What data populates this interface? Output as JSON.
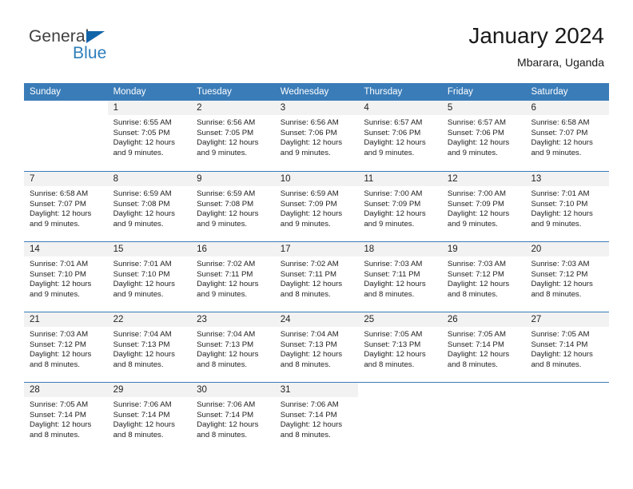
{
  "brand": {
    "name_top": "General",
    "name_bottom": "Blue",
    "color_top": "#3f3f3f",
    "color_bottom": "#2e7ebb",
    "triangle_color": "#1264a9"
  },
  "header": {
    "title": "January 2024",
    "subtitle": "Mbarara, Uganda"
  },
  "theme": {
    "header_band": "#3a7cb8",
    "day_number_band": "#f2f2f2",
    "text": "#222222"
  },
  "weekdays": [
    "Sunday",
    "Monday",
    "Tuesday",
    "Wednesday",
    "Thursday",
    "Friday",
    "Saturday"
  ],
  "weeks": [
    [
      {
        "num": "",
        "sunrise": "",
        "sunset": "",
        "daylight1": "",
        "daylight2": ""
      },
      {
        "num": "1",
        "sunrise": "Sunrise: 6:55 AM",
        "sunset": "Sunset: 7:05 PM",
        "daylight1": "Daylight: 12 hours",
        "daylight2": "and 9 minutes."
      },
      {
        "num": "2",
        "sunrise": "Sunrise: 6:56 AM",
        "sunset": "Sunset: 7:05 PM",
        "daylight1": "Daylight: 12 hours",
        "daylight2": "and 9 minutes."
      },
      {
        "num": "3",
        "sunrise": "Sunrise: 6:56 AM",
        "sunset": "Sunset: 7:06 PM",
        "daylight1": "Daylight: 12 hours",
        "daylight2": "and 9 minutes."
      },
      {
        "num": "4",
        "sunrise": "Sunrise: 6:57 AM",
        "sunset": "Sunset: 7:06 PM",
        "daylight1": "Daylight: 12 hours",
        "daylight2": "and 9 minutes."
      },
      {
        "num": "5",
        "sunrise": "Sunrise: 6:57 AM",
        "sunset": "Sunset: 7:06 PM",
        "daylight1": "Daylight: 12 hours",
        "daylight2": "and 9 minutes."
      },
      {
        "num": "6",
        "sunrise": "Sunrise: 6:58 AM",
        "sunset": "Sunset: 7:07 PM",
        "daylight1": "Daylight: 12 hours",
        "daylight2": "and 9 minutes."
      }
    ],
    [
      {
        "num": "7",
        "sunrise": "Sunrise: 6:58 AM",
        "sunset": "Sunset: 7:07 PM",
        "daylight1": "Daylight: 12 hours",
        "daylight2": "and 9 minutes."
      },
      {
        "num": "8",
        "sunrise": "Sunrise: 6:59 AM",
        "sunset": "Sunset: 7:08 PM",
        "daylight1": "Daylight: 12 hours",
        "daylight2": "and 9 minutes."
      },
      {
        "num": "9",
        "sunrise": "Sunrise: 6:59 AM",
        "sunset": "Sunset: 7:08 PM",
        "daylight1": "Daylight: 12 hours",
        "daylight2": "and 9 minutes."
      },
      {
        "num": "10",
        "sunrise": "Sunrise: 6:59 AM",
        "sunset": "Sunset: 7:09 PM",
        "daylight1": "Daylight: 12 hours",
        "daylight2": "and 9 minutes."
      },
      {
        "num": "11",
        "sunrise": "Sunrise: 7:00 AM",
        "sunset": "Sunset: 7:09 PM",
        "daylight1": "Daylight: 12 hours",
        "daylight2": "and 9 minutes."
      },
      {
        "num": "12",
        "sunrise": "Sunrise: 7:00 AM",
        "sunset": "Sunset: 7:09 PM",
        "daylight1": "Daylight: 12 hours",
        "daylight2": "and 9 minutes."
      },
      {
        "num": "13",
        "sunrise": "Sunrise: 7:01 AM",
        "sunset": "Sunset: 7:10 PM",
        "daylight1": "Daylight: 12 hours",
        "daylight2": "and 9 minutes."
      }
    ],
    [
      {
        "num": "14",
        "sunrise": "Sunrise: 7:01 AM",
        "sunset": "Sunset: 7:10 PM",
        "daylight1": "Daylight: 12 hours",
        "daylight2": "and 9 minutes."
      },
      {
        "num": "15",
        "sunrise": "Sunrise: 7:01 AM",
        "sunset": "Sunset: 7:10 PM",
        "daylight1": "Daylight: 12 hours",
        "daylight2": "and 9 minutes."
      },
      {
        "num": "16",
        "sunrise": "Sunrise: 7:02 AM",
        "sunset": "Sunset: 7:11 PM",
        "daylight1": "Daylight: 12 hours",
        "daylight2": "and 9 minutes."
      },
      {
        "num": "17",
        "sunrise": "Sunrise: 7:02 AM",
        "sunset": "Sunset: 7:11 PM",
        "daylight1": "Daylight: 12 hours",
        "daylight2": "and 8 minutes."
      },
      {
        "num": "18",
        "sunrise": "Sunrise: 7:03 AM",
        "sunset": "Sunset: 7:11 PM",
        "daylight1": "Daylight: 12 hours",
        "daylight2": "and 8 minutes."
      },
      {
        "num": "19",
        "sunrise": "Sunrise: 7:03 AM",
        "sunset": "Sunset: 7:12 PM",
        "daylight1": "Daylight: 12 hours",
        "daylight2": "and 8 minutes."
      },
      {
        "num": "20",
        "sunrise": "Sunrise: 7:03 AM",
        "sunset": "Sunset: 7:12 PM",
        "daylight1": "Daylight: 12 hours",
        "daylight2": "and 8 minutes."
      }
    ],
    [
      {
        "num": "21",
        "sunrise": "Sunrise: 7:03 AM",
        "sunset": "Sunset: 7:12 PM",
        "daylight1": "Daylight: 12 hours",
        "daylight2": "and 8 minutes."
      },
      {
        "num": "22",
        "sunrise": "Sunrise: 7:04 AM",
        "sunset": "Sunset: 7:13 PM",
        "daylight1": "Daylight: 12 hours",
        "daylight2": "and 8 minutes."
      },
      {
        "num": "23",
        "sunrise": "Sunrise: 7:04 AM",
        "sunset": "Sunset: 7:13 PM",
        "daylight1": "Daylight: 12 hours",
        "daylight2": "and 8 minutes."
      },
      {
        "num": "24",
        "sunrise": "Sunrise: 7:04 AM",
        "sunset": "Sunset: 7:13 PM",
        "daylight1": "Daylight: 12 hours",
        "daylight2": "and 8 minutes."
      },
      {
        "num": "25",
        "sunrise": "Sunrise: 7:05 AM",
        "sunset": "Sunset: 7:13 PM",
        "daylight1": "Daylight: 12 hours",
        "daylight2": "and 8 minutes."
      },
      {
        "num": "26",
        "sunrise": "Sunrise: 7:05 AM",
        "sunset": "Sunset: 7:14 PM",
        "daylight1": "Daylight: 12 hours",
        "daylight2": "and 8 minutes."
      },
      {
        "num": "27",
        "sunrise": "Sunrise: 7:05 AM",
        "sunset": "Sunset: 7:14 PM",
        "daylight1": "Daylight: 12 hours",
        "daylight2": "and 8 minutes."
      }
    ],
    [
      {
        "num": "28",
        "sunrise": "Sunrise: 7:05 AM",
        "sunset": "Sunset: 7:14 PM",
        "daylight1": "Daylight: 12 hours",
        "daylight2": "and 8 minutes."
      },
      {
        "num": "29",
        "sunrise": "Sunrise: 7:06 AM",
        "sunset": "Sunset: 7:14 PM",
        "daylight1": "Daylight: 12 hours",
        "daylight2": "and 8 minutes."
      },
      {
        "num": "30",
        "sunrise": "Sunrise: 7:06 AM",
        "sunset": "Sunset: 7:14 PM",
        "daylight1": "Daylight: 12 hours",
        "daylight2": "and 8 minutes."
      },
      {
        "num": "31",
        "sunrise": "Sunrise: 7:06 AM",
        "sunset": "Sunset: 7:14 PM",
        "daylight1": "Daylight: 12 hours",
        "daylight2": "and 8 minutes."
      },
      {
        "num": "",
        "sunrise": "",
        "sunset": "",
        "daylight1": "",
        "daylight2": ""
      },
      {
        "num": "",
        "sunrise": "",
        "sunset": "",
        "daylight1": "",
        "daylight2": ""
      },
      {
        "num": "",
        "sunrise": "",
        "sunset": "",
        "daylight1": "",
        "daylight2": ""
      }
    ]
  ]
}
